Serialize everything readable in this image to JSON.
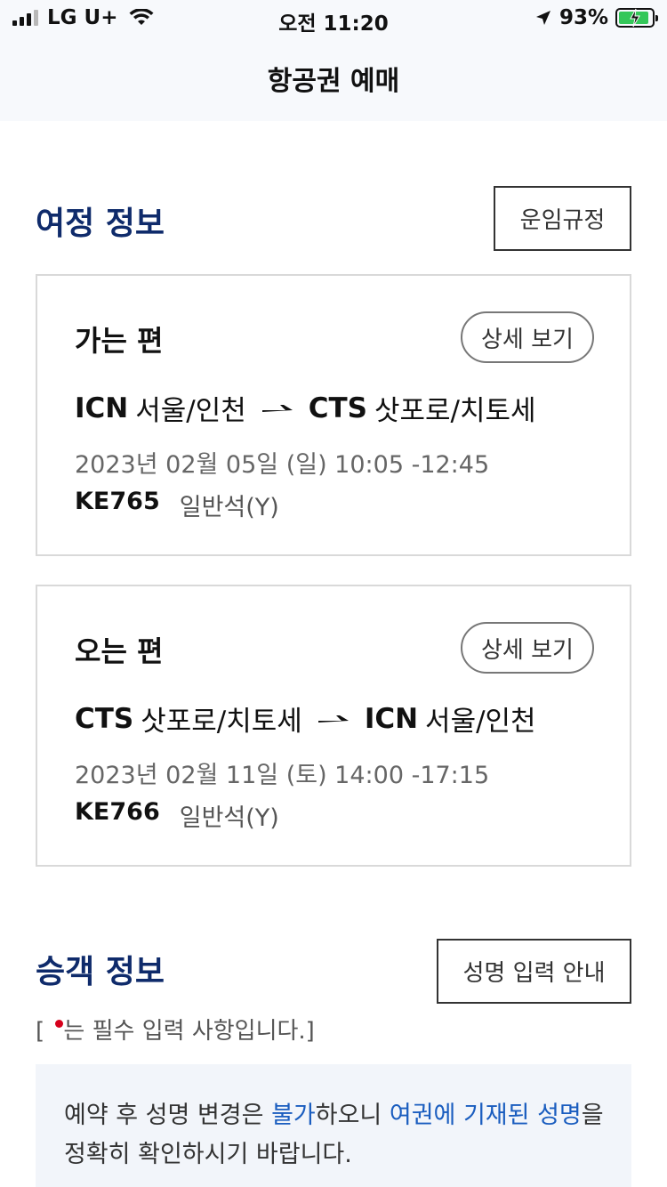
{
  "status_bar": {
    "carrier": "LG U+",
    "time": "오전 11:20",
    "battery": "93%",
    "battery_level": 0.93
  },
  "header": {
    "title": "항공권 예매"
  },
  "itinerary": {
    "title": "여정 정보",
    "fare_rules_button": "운임규정",
    "outbound": {
      "label": "가는 편",
      "detail_button": "상세 보기",
      "from_code": "ICN",
      "from_city": "서울/인천",
      "to_code": "CTS",
      "to_city": "삿포로/치토세",
      "datetime": "2023년 02월 05일 (일) 10:05 -12:45",
      "flight_no": "KE765",
      "cabin": "일반석(Y)"
    },
    "inbound": {
      "label": "오는 편",
      "detail_button": "상세 보기",
      "from_code": "CTS",
      "from_city": "삿포로/치토세",
      "to_code": "ICN",
      "to_city": "서울/인천",
      "datetime": "2023년 02월 11일 (토) 14:00 -17:15",
      "flight_no": "KE766",
      "cabin": "일반석(Y)"
    }
  },
  "passenger": {
    "title": "승객 정보",
    "name_guide_button": "성명 입력 안내",
    "required_note_open": "[",
    "required_note_text": "는 필수 입력 사항입니다.]",
    "notice": {
      "p1": "예약 후 성명 변경은 ",
      "p2": "불가",
      "p3": "하오니 ",
      "p4": "여권에 기재된 성명",
      "p5": "을 정확히 확인하시기 바랍니다."
    }
  },
  "colors": {
    "section_title": "#0f2b6b",
    "link_blue": "#1a5dbf",
    "required_dot": "#d6001c",
    "battery_green": "#34c759"
  }
}
